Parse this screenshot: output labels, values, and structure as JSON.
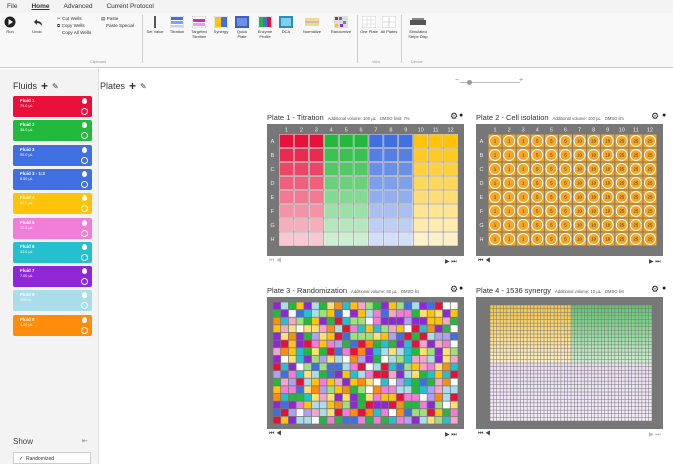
{
  "menu": [
    "File",
    "Home",
    "Advanced",
    "Current Protocol"
  ],
  "ribbon": {
    "run": "Run",
    "undo": "Undo",
    "cut_wells": "Cut Wells",
    "copy_wells": "Copy Wells",
    "copy_all_wells": "Copy All Wells",
    "paste": "Paste",
    "paste_special": "Paste Special",
    "set_value": "Set Value",
    "titration": "Titration",
    "targeted_titration": "Targeted Titration",
    "synergy": "Synergy",
    "quick_plate": "Quick Plate",
    "enzyme_profile": "Enzyme Profile",
    "dca": "DCA",
    "normalize": "Normalize",
    "randomize": "Randomize",
    "one_plate": "One Plate",
    "all_plates": "All Plates",
    "simulated_stripe_dish": "Simulated Stripe Disp",
    "group_clipboard": "Clipboard",
    "group_view": "View",
    "group_device": "Device"
  },
  "fluids_panel": {
    "title": "Fluids",
    "items": [
      {
        "name": "Fluid 1",
        "volume": "79.0 µL",
        "color": "#e8103a"
      },
      {
        "name": "Fluid 2",
        "volume": "36.0 µL",
        "color": "#22b93c"
      },
      {
        "name": "Fluid 3",
        "volume": "90.0 µL",
        "color": "#3f6fe0"
      },
      {
        "name": "Fluid 3 - 1:2",
        "volume": "8.50 µL",
        "color": "#3f6fe0"
      },
      {
        "name": "Fluid 4",
        "volume": "47.0 µL",
        "color": "#ffc30a"
      },
      {
        "name": "Fluid 5",
        "volume": "72.0 µL",
        "color": "#f07ed9"
      },
      {
        "name": "Fluid 6",
        "volume": "32.0 µL",
        "color": "#25c0ce"
      },
      {
        "name": "Fluid 7",
        "volume": "7.00 µL",
        "color": "#8d27d8"
      },
      {
        "name": "Fluid 8",
        "volume": "300 nL",
        "color": "#a9ddea"
      },
      {
        "name": "Fluid 9",
        "volume": "2.00 µL",
        "color": "#ff8c0a"
      }
    ],
    "show_label": "Show",
    "show_option": "Randomized"
  },
  "plates_panel": {
    "title": "Plates"
  },
  "plates": [
    {
      "title": "Plate 1 - Titration",
      "subtitle": "Additional volume: 100 µL",
      "tag": "DMSO limit: 7%"
    },
    {
      "title": "Plate 2 - Cell isolation",
      "subtitle": "Additional volume: 100 µL",
      "tag": "DMSO lim"
    },
    {
      "title": "Plate 3 - Randomization",
      "subtitle": "Additional volume: 50 µL",
      "tag": "DMSO lin"
    },
    {
      "title": "Plate 4 - 1536 synergy",
      "subtitle": "Additional volume: 10 µL",
      "tag": "DMSO lim"
    }
  ],
  "plate_cols": [
    "1",
    "2",
    "3",
    "4",
    "5",
    "6",
    "7",
    "8",
    "9",
    "10",
    "11",
    "12"
  ],
  "plate_rows": [
    "A",
    "B",
    "C",
    "D",
    "E",
    "F",
    "G",
    "H"
  ],
  "plate2_values": [
    [
      "1",
      "1",
      "1",
      "5",
      "5",
      "5",
      "10",
      "10",
      "10",
      "25",
      "25",
      "25"
    ],
    [
      "1",
      "1",
      "1",
      "5",
      "5",
      "5",
      "10",
      "10",
      "10",
      "25",
      "25",
      "25"
    ],
    [
      "1",
      "1",
      "1",
      "5",
      "5",
      "5",
      "10",
      "10",
      "10",
      "25",
      "25",
      "25"
    ],
    [
      "1",
      "1",
      "1",
      "5",
      "5",
      "5",
      "10",
      "10",
      "10",
      "25",
      "25",
      "25"
    ],
    [
      "1",
      "1",
      "1",
      "5",
      "5",
      "5",
      "10",
      "10",
      "10",
      "25",
      "25",
      "25"
    ],
    [
      "1",
      "1",
      "1",
      "5",
      "5",
      "5",
      "10",
      "10",
      "10",
      "25",
      "25",
      "25"
    ],
    [
      "1",
      "1",
      "1",
      "5",
      "5",
      "5",
      "10",
      "10",
      "10",
      "25",
      "25",
      "25"
    ],
    [
      "1",
      "1",
      "1",
      "5",
      "5",
      "5",
      "10",
      "10",
      "10",
      "25",
      "25",
      "25"
    ]
  ],
  "colors": {
    "titration": [
      "#e8103a",
      "#22b93c",
      "#3f6fe0",
      "#ffc30a"
    ],
    "well_orange": "#f5a623",
    "plate_bg": "#777777",
    "synergy_a": "#f5c545",
    "synergy_b": "#5fc76e",
    "synergy_c": "#e8d9f0"
  }
}
